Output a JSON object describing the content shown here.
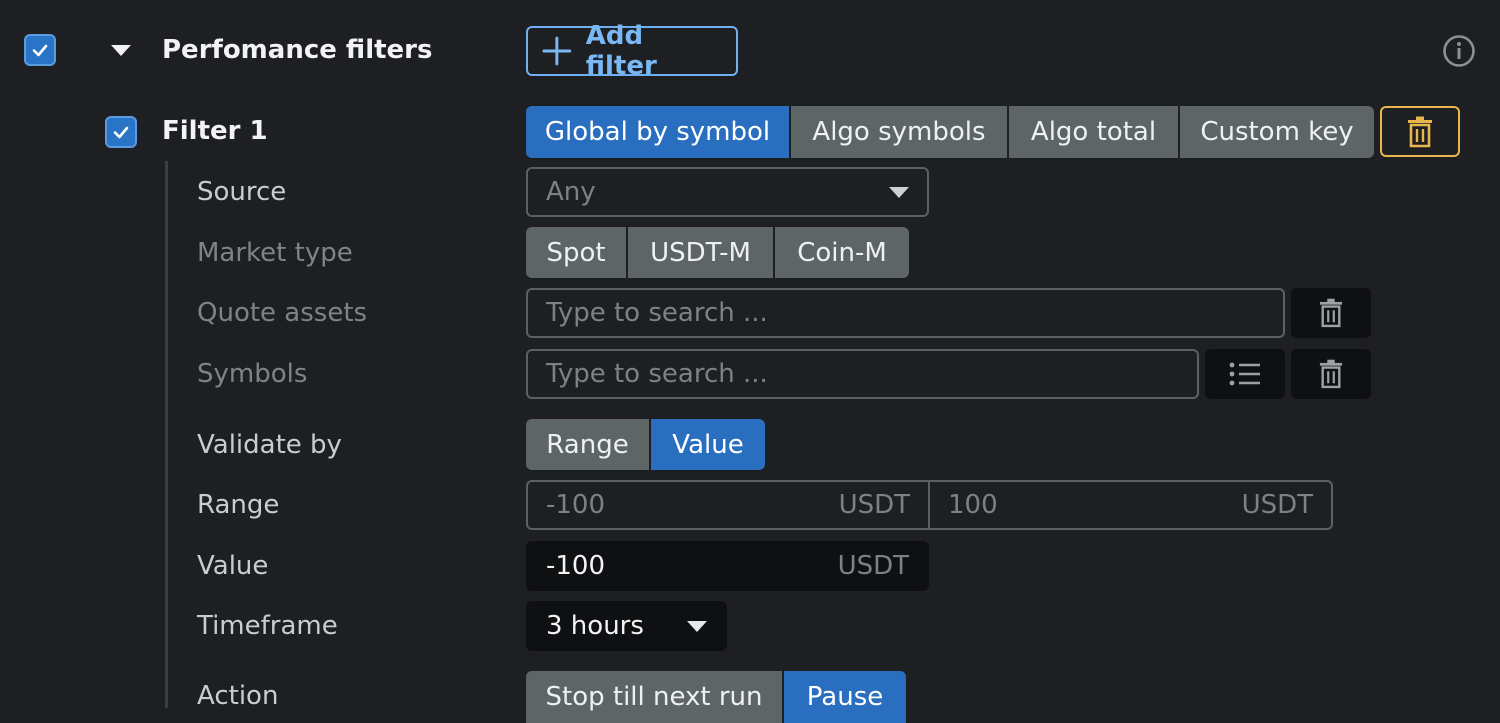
{
  "header": {
    "title": "Perfomance filters",
    "add_filter_label": "Add filter",
    "enabled": true
  },
  "filter": {
    "title": "Filter 1",
    "enabled": true,
    "scope_tabs": [
      "Global by symbol",
      "Algo symbols",
      "Algo total",
      "Custom key"
    ],
    "scope_selected": "Global by symbol"
  },
  "fields": {
    "source_label": "Source",
    "source_value": "Any",
    "market_type_label": "Market type",
    "market_types": [
      "Spot",
      "USDT-M",
      "Coin-M"
    ],
    "quote_assets_label": "Quote assets",
    "quote_assets_placeholder": "Type to search ...",
    "symbols_label": "Symbols",
    "symbols_placeholder": "Type to search ...",
    "validate_by_label": "Validate by",
    "validate_by_options": [
      "Range",
      "Value"
    ],
    "validate_by_selected": "Value",
    "range_label": "Range",
    "range_min": "-100",
    "range_min_unit": "USDT",
    "range_max": "100",
    "range_max_unit": "USDT",
    "value_label": "Value",
    "value": "-100",
    "value_unit": "USDT",
    "timeframe_label": "Timeframe",
    "timeframe_value": "3 hours",
    "action_label": "Action",
    "action_options": [
      "Stop till next run",
      "Pause"
    ],
    "action_selected": "Pause"
  },
  "colors": {
    "background": "#1e1f22",
    "accent_blue": "#2a6ebf",
    "segment_gray": "#5d6567",
    "delete_yellow": "#e8b64c"
  }
}
